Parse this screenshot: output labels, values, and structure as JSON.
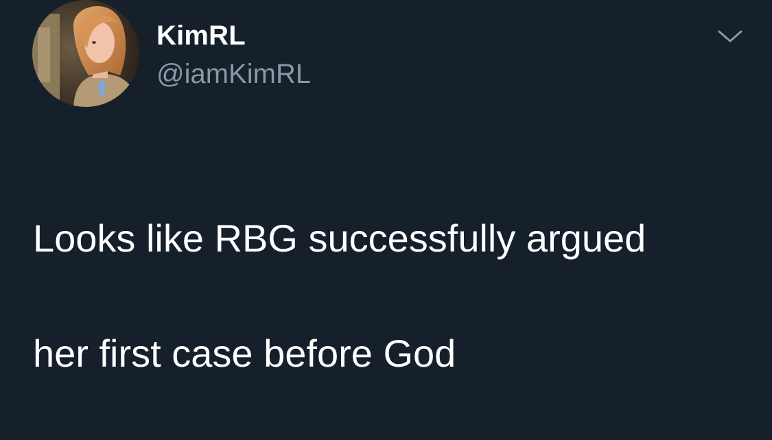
{
  "tweet": {
    "author": {
      "display_name": "KimRL",
      "handle": "@iamKimRL",
      "avatar_icon": "profile-photo"
    },
    "menu_icon": "chevron-down-icon",
    "text_line_1": "Looks like RBG successfully argued",
    "text_line_2": "her first case before God"
  },
  "colors": {
    "background": "#15202b",
    "primary_text": "#ffffff",
    "secondary_text": "#8899a6"
  }
}
